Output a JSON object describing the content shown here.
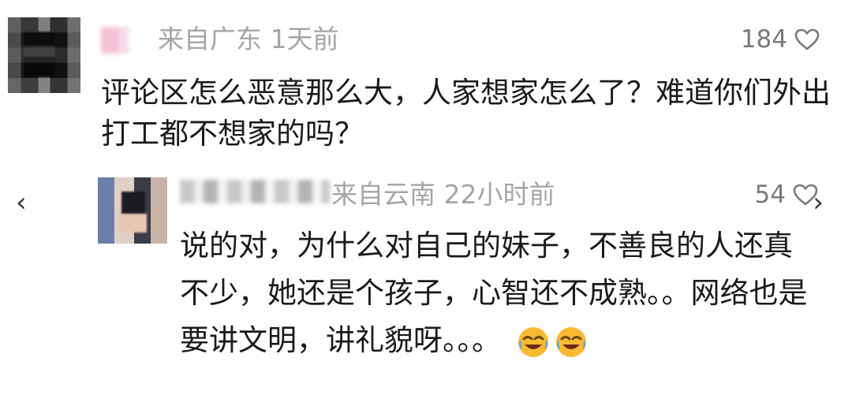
{
  "comments": {
    "main": {
      "location_time": "来自广东 1天前",
      "likes": "184",
      "text": "评论区怎么恶意那么大，人家想家怎么了？难道你们外出打工都不想家的吗？",
      "like_icon": "heart-outline-icon"
    },
    "reply": {
      "location_time": "来自云南 22小时前",
      "likes": "54",
      "text": "说的对，为什么对自己的妹子，不善良的人还真不少，她还是个孩子，心智还不成熟。。网络也是要讲文明，讲礼貌呀。。。",
      "emojis": [
        "rolling-laughing-crying-face-icon",
        "rolling-laughing-crying-face-icon"
      ],
      "like_icon": "heart-outline-icon"
    }
  },
  "navigation": {
    "prev_icon": "chevron-left-icon",
    "prev_glyph": "‹",
    "next_icon": "chevron-right-icon",
    "next_glyph": "›"
  },
  "colors": {
    "meta_text": "#a6a6a6",
    "body_text": "#1a1a1a",
    "like_text": "#7a7a7a",
    "emoji_fill": "#f9b933",
    "emoji_tear": "#4aa6f0"
  }
}
